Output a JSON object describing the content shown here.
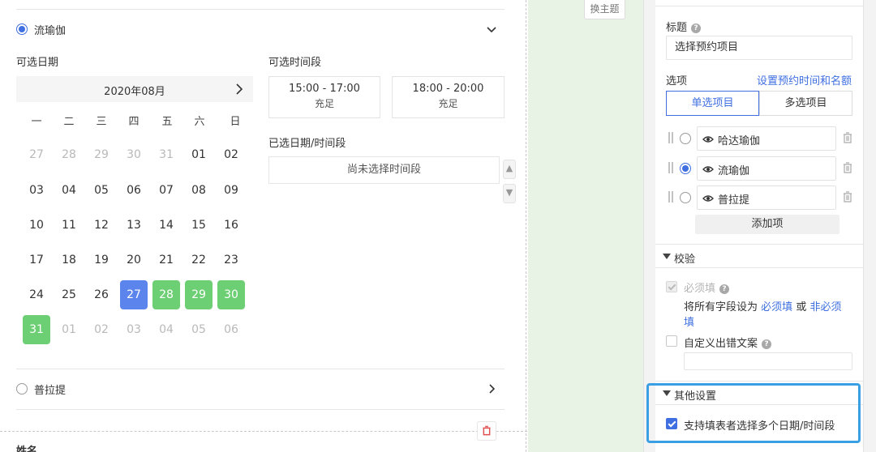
{
  "left": {
    "option_liu": "流瑜伽",
    "option_pu": "普拉提",
    "date_label": "可选日期",
    "timeslot_label": "可选时间段",
    "calendar_title": "2020年08月",
    "weekdays": [
      "一",
      "二",
      "三",
      "四",
      "五",
      "六",
      "日"
    ],
    "weeks": [
      [
        {
          "d": "27",
          "s": "muted"
        },
        {
          "d": "28",
          "s": "muted"
        },
        {
          "d": "29",
          "s": "muted"
        },
        {
          "d": "30",
          "s": "muted"
        },
        {
          "d": "31",
          "s": "muted"
        },
        {
          "d": "01",
          "s": ""
        },
        {
          "d": "02",
          "s": ""
        }
      ],
      [
        {
          "d": "03",
          "s": ""
        },
        {
          "d": "04",
          "s": ""
        },
        {
          "d": "05",
          "s": ""
        },
        {
          "d": "06",
          "s": ""
        },
        {
          "d": "07",
          "s": ""
        },
        {
          "d": "08",
          "s": ""
        },
        {
          "d": "09",
          "s": ""
        }
      ],
      [
        {
          "d": "10",
          "s": ""
        },
        {
          "d": "11",
          "s": ""
        },
        {
          "d": "12",
          "s": ""
        },
        {
          "d": "13",
          "s": ""
        },
        {
          "d": "14",
          "s": ""
        },
        {
          "d": "15",
          "s": ""
        },
        {
          "d": "16",
          "s": ""
        }
      ],
      [
        {
          "d": "17",
          "s": ""
        },
        {
          "d": "18",
          "s": ""
        },
        {
          "d": "19",
          "s": ""
        },
        {
          "d": "20",
          "s": ""
        },
        {
          "d": "21",
          "s": ""
        },
        {
          "d": "22",
          "s": ""
        },
        {
          "d": "23",
          "s": ""
        }
      ],
      [
        {
          "d": "24",
          "s": ""
        },
        {
          "d": "25",
          "s": ""
        },
        {
          "d": "26",
          "s": ""
        },
        {
          "d": "27",
          "s": "sel-blue"
        },
        {
          "d": "28",
          "s": "sel-green"
        },
        {
          "d": "29",
          "s": "sel-green"
        },
        {
          "d": "30",
          "s": "sel-green"
        }
      ],
      [
        {
          "d": "31",
          "s": "sel-green"
        },
        {
          "d": "01",
          "s": "muted"
        },
        {
          "d": "02",
          "s": "muted"
        },
        {
          "d": "03",
          "s": "muted"
        },
        {
          "d": "04",
          "s": "muted"
        },
        {
          "d": "05",
          "s": "muted"
        },
        {
          "d": "06",
          "s": "muted"
        }
      ]
    ],
    "slots": [
      {
        "time": "15:00 - 17:00",
        "status": "充足"
      },
      {
        "time": "18:00 - 20:00",
        "status": "充足"
      }
    ],
    "picked_label": "已选日期/时间段",
    "picked_empty": "尚未选择时间段",
    "cut_label": "姓名"
  },
  "mid": {
    "theme_button": "换主题"
  },
  "right": {
    "title_label": "标题",
    "title_value": "选择预约项目",
    "options_label": "选项",
    "options_link": "设置预约时间和名额",
    "seg_single": "单选项目",
    "seg_multi": "多选项目",
    "items": [
      {
        "label": "哈达瑜伽",
        "selected": false
      },
      {
        "label": "流瑜伽",
        "selected": true
      },
      {
        "label": "普拉提",
        "selected": false
      }
    ],
    "add_item": "添加项",
    "validate_title": "校验",
    "required_label": "必须填",
    "all_fields_prefix": "将所有字段设为",
    "set_required": "必须填",
    "or_text": "或",
    "set_optional": "非必须填",
    "custom_error_label": "自定义出错文案",
    "other_title": "其他设置",
    "multi_support_label": "支持填表者选择多个日期/时间段"
  },
  "colors": {
    "accent": "#3f6fe0",
    "selected_blue": "#5b84ec",
    "selected_green": "#6dcf73",
    "highlight": "#3aa0e3",
    "canvas_bg": "#e8f3e6"
  }
}
